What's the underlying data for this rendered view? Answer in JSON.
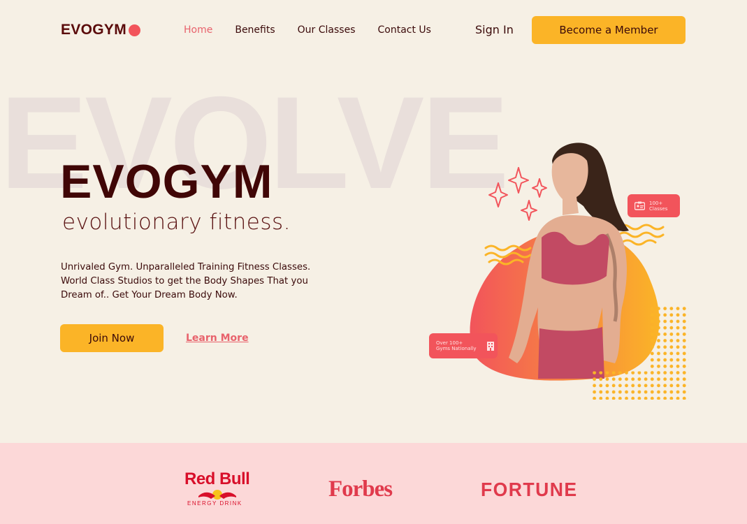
{
  "nav": {
    "logo": "EVOGYM",
    "links": [
      "Home",
      "Benefits",
      "Our Classes",
      "Contact Us"
    ],
    "sign_in": "Sign In",
    "cta": "Become a Member"
  },
  "hero": {
    "background_word": "EVOLVE",
    "title": "EVOGYM",
    "subtitle": "evolutionary fitness.",
    "description": "Unrivaled Gym. Unparalleled Training Fitness Classes. World Class Studios to get the Body Shapes That you Dream of.. Get Your Dream Body Now.",
    "join_label": "Join Now",
    "learn_label": "Learn More"
  },
  "badges": {
    "classes_line1": "100+",
    "classes_line2": "Classes",
    "gyms_line1": "Over 100+",
    "gyms_line2": "Gyms Nationally"
  },
  "sponsors": {
    "redbull": "Red Bull",
    "redbull_sub": "ENERGY DRINK",
    "forbes": "Forbes",
    "fortune": "FORTUNE"
  },
  "colors": {
    "background": "#f6f0e5",
    "primary_accent": "#fbb427",
    "secondary_accent": "#f2545b",
    "text_dark": "#400606",
    "sponsor_band": "#fcd8d8"
  }
}
